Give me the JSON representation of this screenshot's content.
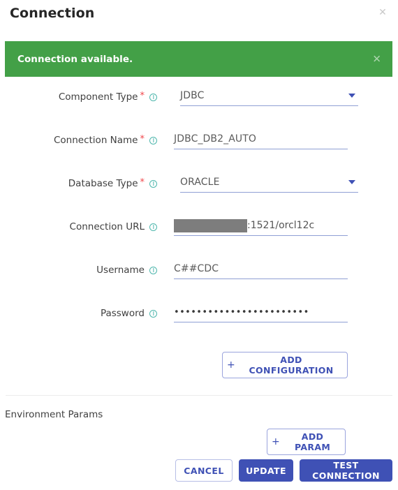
{
  "header": {
    "title": "Connection",
    "close_icon": "close-icon",
    "close_glyph": "✕"
  },
  "alert": {
    "message": "Connection available.",
    "close_glyph": "✕",
    "background_color": "#43a047",
    "text_color": "#ffffff"
  },
  "form": {
    "fields": [
      {
        "label": "Component Type",
        "required": true,
        "info_icon": "info-icon",
        "type": "select",
        "value": "JDBC"
      },
      {
        "label": "Connection Name",
        "required": true,
        "info_icon": "info-icon",
        "type": "text",
        "value": "JDBC_DB2_AUTO"
      },
      {
        "label": "Database Type",
        "required": true,
        "info_icon": "info-icon",
        "type": "select",
        "value": "ORACLE"
      },
      {
        "label": "Connection URL",
        "required": false,
        "info_icon": "info-icon",
        "type": "redacted-text",
        "value": ":1521/orcl12c"
      },
      {
        "label": "Username",
        "required": false,
        "info_icon": "info-icon",
        "type": "text",
        "value": "C##CDC"
      },
      {
        "label": "Password",
        "required": false,
        "info_icon": "info-icon",
        "type": "password",
        "value": "••••••••••••••••••••••••"
      }
    ],
    "add_configuration_label": "ADD CONFIGURATION",
    "plus_glyph": "+"
  },
  "environment": {
    "section_label": "Environment Params",
    "add_param_label": "ADD PARAM",
    "plus_glyph": "+"
  },
  "footer": {
    "cancel_label": "CANCEL",
    "update_label": "UPDATE",
    "test_connection_label": "TEST CONNECTION"
  },
  "colors": {
    "accent": "#3f51b5",
    "success": "#43a047",
    "required": "#f0464a",
    "info": "#4db6ac",
    "underline": "#8f9fd4"
  }
}
